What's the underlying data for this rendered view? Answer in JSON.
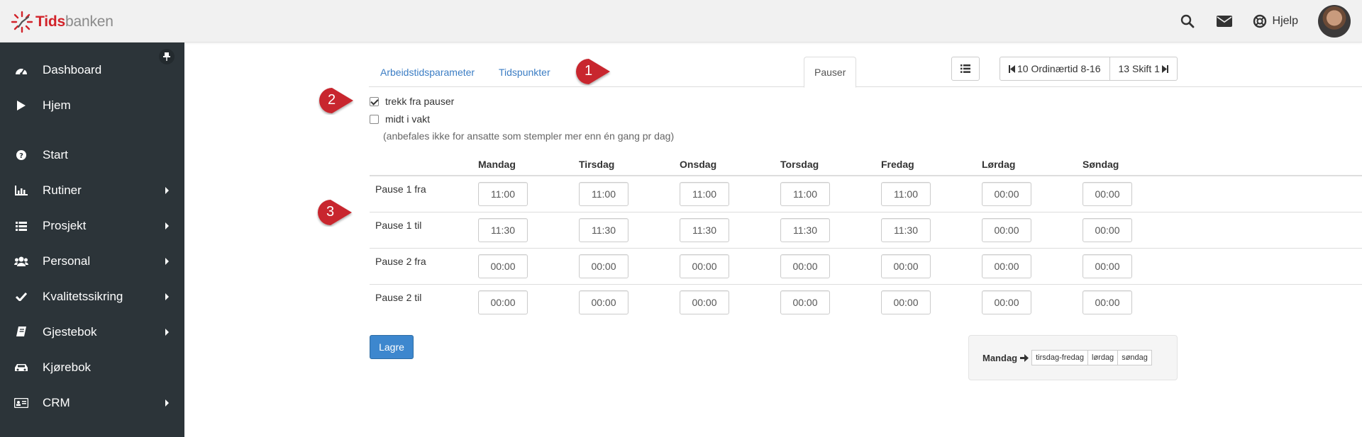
{
  "app": {
    "logo_brand_bold": "Tids",
    "logo_brand_light": "banken",
    "help_label": "Hjelp",
    "icons": [
      "search-icon",
      "envelope-icon",
      "lifebuoy-icon"
    ]
  },
  "sidebar": {
    "items": [
      {
        "label": "Dashboard",
        "icon": "dashboard-icon",
        "submenu": false
      },
      {
        "label": "Hjem",
        "icon": "play-icon",
        "submenu": false
      },
      {
        "label": "Start",
        "icon": "question-icon",
        "submenu": false
      },
      {
        "label": "Rutiner",
        "icon": "bar-chart-icon",
        "submenu": true
      },
      {
        "label": "Prosjekt",
        "icon": "list-icon",
        "submenu": true
      },
      {
        "label": "Personal",
        "icon": "users-icon",
        "submenu": true
      },
      {
        "label": "Kvalitetssikring",
        "icon": "check-icon",
        "submenu": true
      },
      {
        "label": "Gjestebok",
        "icon": "book-icon",
        "submenu": true
      },
      {
        "label": "Kjørebok",
        "icon": "car-icon",
        "submenu": false
      },
      {
        "label": "CRM",
        "icon": "id-card-icon",
        "submenu": true
      }
    ]
  },
  "tabs": [
    {
      "label": "Arbeidstidsparameter",
      "active": false
    },
    {
      "label": "Tidspunkter",
      "active": false
    },
    {
      "label": "Pauser",
      "active": true
    }
  ],
  "nav": {
    "prev_label": "10 Ordinærtid 8-16",
    "next_label": "13 Skift 1"
  },
  "options": {
    "deduct_breaks": {
      "label": "trekk fra pauser",
      "checked": true
    },
    "mid_shift": {
      "label": "midt i vakt",
      "checked": false
    },
    "note": "(anbefales ikke for ansatte som stempler mer enn én gang pr dag)"
  },
  "table": {
    "days": [
      "Mandag",
      "Tirsdag",
      "Onsdag",
      "Torsdag",
      "Fredag",
      "Lørdag",
      "Søndag"
    ],
    "rows": [
      {
        "label": "Pause 1 fra",
        "values": [
          "11:00",
          "11:00",
          "11:00",
          "11:00",
          "11:00",
          "00:00",
          "00:00"
        ]
      },
      {
        "label": "Pause 1 til",
        "values": [
          "11:30",
          "11:30",
          "11:30",
          "11:30",
          "11:30",
          "00:00",
          "00:00"
        ]
      },
      {
        "label": "Pause 2 fra",
        "values": [
          "00:00",
          "00:00",
          "00:00",
          "00:00",
          "00:00",
          "00:00",
          "00:00"
        ]
      },
      {
        "label": "Pause 2 til",
        "values": [
          "00:00",
          "00:00",
          "00:00",
          "00:00",
          "00:00",
          "00:00",
          "00:00"
        ]
      }
    ]
  },
  "save_label": "Lagre",
  "copy": {
    "from_label": "Mandag",
    "targets": [
      "tirsdag-fredag",
      "lørdag",
      "søndag"
    ]
  },
  "markers": [
    "1",
    "2",
    "3"
  ],
  "colors": {
    "sidebar_bg": "#2c3439",
    "accent_blue": "#3d87ce",
    "marker_red": "#c8282e",
    "brand_red": "#d2232a"
  }
}
